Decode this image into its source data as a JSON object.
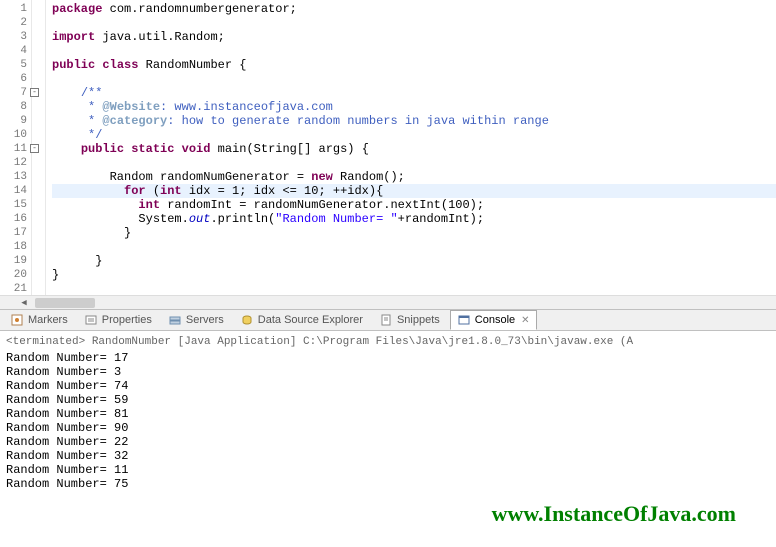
{
  "code": {
    "lines": [
      {
        "n": 1,
        "html": "<span class='kw'>package</span> com.randomnumbergenerator;"
      },
      {
        "n": 2,
        "html": ""
      },
      {
        "n": 3,
        "html": "<span class='kw'>import</span> java.util.Random;"
      },
      {
        "n": 4,
        "html": ""
      },
      {
        "n": 5,
        "html": "<span class='kw'>public</span> <span class='kw'>class</span> RandomNumber {"
      },
      {
        "n": 6,
        "html": ""
      },
      {
        "n": 7,
        "html": "    <span class='doc'>/**</span>",
        "fold": true
      },
      {
        "n": 8,
        "html": "<span class='doc'>     * </span><span class='doctag'>@Website</span><span class='doc'>: www.instanceofjava.com</span>"
      },
      {
        "n": 9,
        "html": "<span class='doc'>     * </span><span class='doctag'>@category</span><span class='doc'>: how to generate random numbers in java within range</span>"
      },
      {
        "n": 10,
        "html": "<span class='doc'>     */</span>"
      },
      {
        "n": 11,
        "html": "    <span class='kw'>public</span> <span class='kw'>static</span> <span class='kw'>void</span> main(String[] args) {",
        "fold": true
      },
      {
        "n": 12,
        "html": ""
      },
      {
        "n": 13,
        "html": "        Random randomNumGenerator = <span class='kw'>new</span> Random();"
      },
      {
        "n": 14,
        "html": "          <span class='kw'>for</span> (<span class='kw'>int</span> idx = 1; idx &lt;= 10; ++idx){",
        "hl": true
      },
      {
        "n": 15,
        "html": "            <span class='kw'>int</span> randomInt = randomNumGenerator.nextInt(100);"
      },
      {
        "n": 16,
        "html": "            System.<span class='static-field'>out</span>.println(<span class='str'>\"Random Number= \"</span>+randomInt);"
      },
      {
        "n": 17,
        "html": "          }"
      },
      {
        "n": 18,
        "html": ""
      },
      {
        "n": 19,
        "html": "      }"
      },
      {
        "n": 20,
        "html": "}"
      },
      {
        "n": 21,
        "html": ""
      }
    ]
  },
  "tabs": {
    "items": [
      {
        "label": "Markers",
        "icon": "markers"
      },
      {
        "label": "Properties",
        "icon": "properties"
      },
      {
        "label": "Servers",
        "icon": "servers"
      },
      {
        "label": "Data Source Explorer",
        "icon": "datasource"
      },
      {
        "label": "Snippets",
        "icon": "snippets"
      },
      {
        "label": "Console",
        "icon": "console",
        "active": true
      }
    ]
  },
  "console": {
    "header": "<terminated> RandomNumber [Java Application] C:\\Program Files\\Java\\jre1.8.0_73\\bin\\javaw.exe (A",
    "lines": [
      "Random Number= 17",
      "Random Number= 3",
      "Random Number= 74",
      "Random Number= 59",
      "Random Number= 81",
      "Random Number= 90",
      "Random Number= 22",
      "Random Number= 32",
      "Random Number= 11",
      "Random Number= 75"
    ]
  },
  "watermark": "www.InstanceOfJava.com"
}
